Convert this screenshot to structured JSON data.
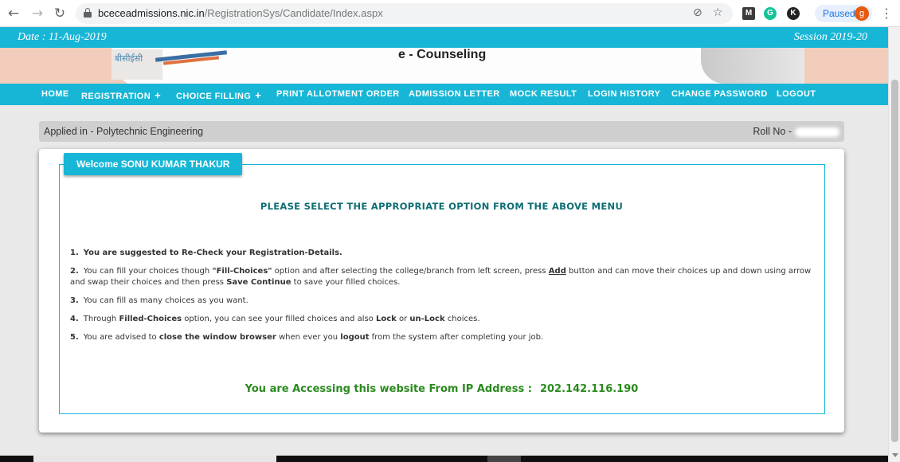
{
  "browser": {
    "url_host": "bceceadmissions.nic.in",
    "url_path": "/RegistrationSys/Candidate/Index.aspx",
    "paused_label": "Paused",
    "profile_initial": "g",
    "ext_g": "G",
    "ext_k": "K"
  },
  "header": {
    "date": "Date : 11-Aug-2019",
    "session": "Session 2019-20",
    "banner_title": "e - Counseling",
    "logo_text": "बीसीईसी"
  },
  "menu": {
    "items": [
      {
        "label": "HOME",
        "has_plus": false
      },
      {
        "label": "REGISTRATION",
        "has_plus": true
      },
      {
        "label": "CHOICE FILLING",
        "has_plus": true
      },
      {
        "label": "PRINT ALLOTMENT ORDER",
        "has_plus": false
      },
      {
        "label": "ADMISSION LETTER",
        "has_plus": false
      },
      {
        "label": "MOCK RESULT",
        "has_plus": false
      },
      {
        "label": "LOGIN HISTORY",
        "has_plus": false
      },
      {
        "label": "CHANGE PASSWORD",
        "has_plus": false
      },
      {
        "label": "LOGOUT",
        "has_plus": false
      }
    ],
    "plus_symbol": "+"
  },
  "applied": {
    "applied_in": "Applied in - Polytechnic Engineering",
    "roll_no_label": "Roll No -"
  },
  "main": {
    "welcome": "Welcome SONU KUMAR THAKUR",
    "headline": "PLEASE SELECT THE APPROPRIATE OPTION FROM THE ABOVE MENU",
    "instructions": {
      "n1": "1.",
      "i1": "You are suggested to Re-Check your Registration-Details.",
      "n2": "2.",
      "i2a": "You can fill your choices though ",
      "i2b": "\"Fill-Choices\"",
      "i2c": " option and after selecting the college/branch from left screen, press ",
      "i2d": "Add",
      "i2e": " button and can move their choices up and down using arrow and swap their choices and then press ",
      "i2f": "Save Continue",
      "i2g": " to save your filled choices.",
      "n3": "3.",
      "i3": "You can fill as many choices as you want.",
      "n4": "4.",
      "i4a": "Through ",
      "i4b": "Filled-Choices",
      "i4c": " option, you can see your filled choices and also ",
      "i4d": "Lock",
      "i4e": " or ",
      "i4f": "un-Lock",
      "i4g": " choices.",
      "n5": "5.",
      "i5a": "You are advised to ",
      "i5b": "close the window browser",
      "i5c": " when ever you ",
      "i5d": "logout",
      "i5e": " from the system after completing your job."
    },
    "ip_label": "You are Accessing this website From IP Address :",
    "ip_address": "202.142.116.190"
  },
  "colors": {
    "accent": "#17b6d6",
    "headline": "#0d6e74",
    "ip_text": "#2b8a1f"
  }
}
